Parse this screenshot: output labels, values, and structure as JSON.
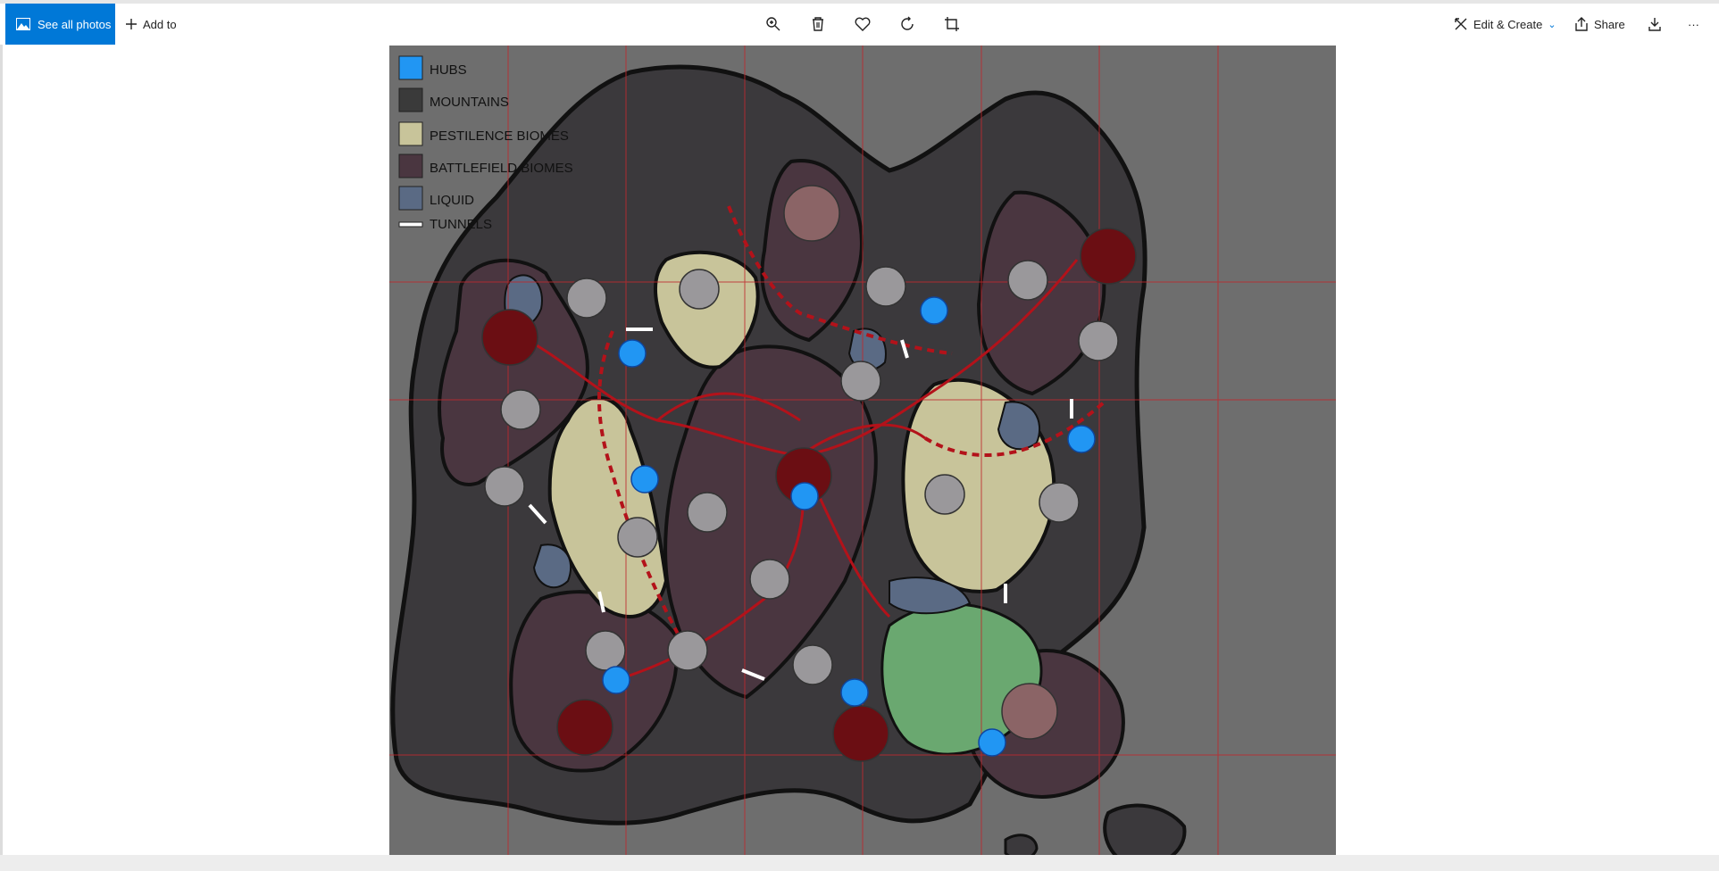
{
  "toolbar": {
    "see_all_label": "See all photos",
    "add_to_label": "Add to",
    "edit_create_label": "Edit & Create",
    "share_label": "Share",
    "more_label": "···",
    "accent_color": "#0078d7"
  },
  "legend": {
    "items": [
      {
        "label": "HUBS",
        "color": "#2196f3"
      },
      {
        "label": "MOUNTAINS",
        "color": "#3a3a3a"
      },
      {
        "label": "PESTILENCE BIOMES",
        "color": "#c8c49a"
      },
      {
        "label": "BATTLEFIELD BIOMES",
        "color": "#4a3640"
      },
      {
        "label": "LIQUID",
        "color": "#5a6a84"
      },
      {
        "label": "TUNNELS",
        "color": "#ffffff"
      }
    ]
  }
}
